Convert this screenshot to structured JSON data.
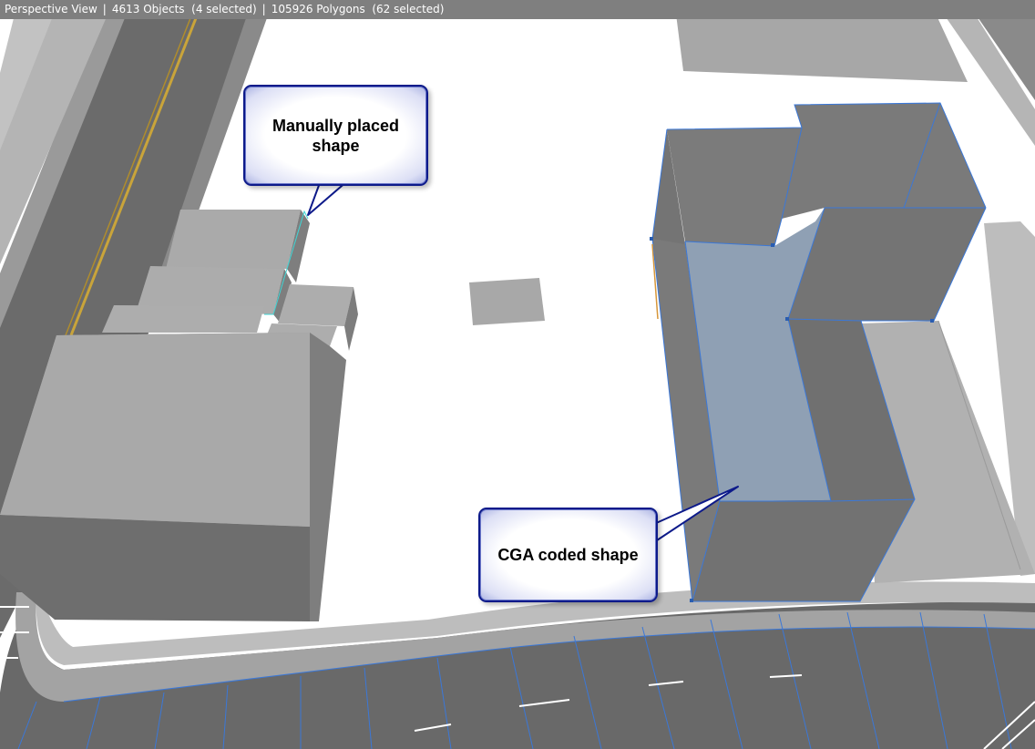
{
  "status": {
    "view_name": "Perspective View",
    "objects": "4613 Objects",
    "objects_selected": "(4 selected)",
    "polygons": "105926 Polygons",
    "polygons_selected": "(62 selected)",
    "separator": "|"
  },
  "callouts": {
    "manual_shape": "Manually placed shape",
    "cga_shape": "CGA coded shape"
  },
  "colors": {
    "status_bar": "#7f7f7f",
    "building_top": "#a9a9a9",
    "building_side": "#7b7b7b",
    "building_dark": "#6f6f6f",
    "road": "#6a6a6a",
    "selection_edge": "#3b78d8",
    "selected_face": "#8fa0b4",
    "callout_border": "#0d1a8a"
  }
}
